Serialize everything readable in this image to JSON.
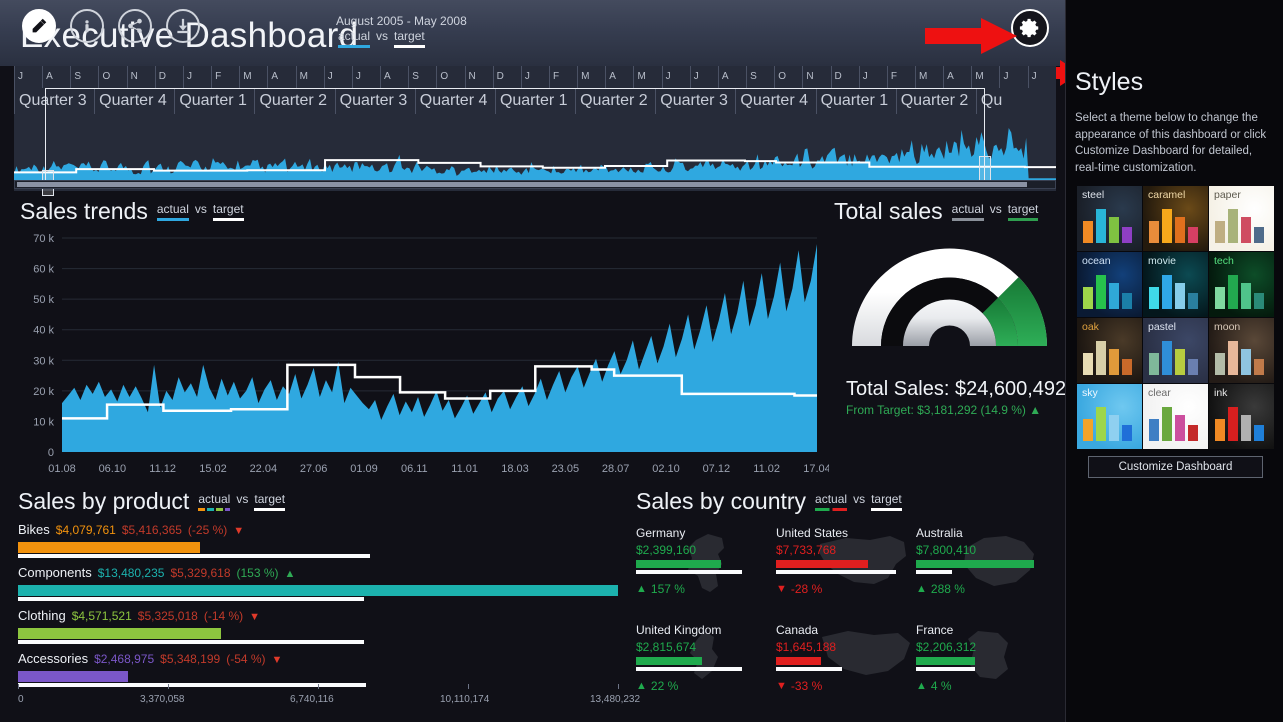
{
  "header": {
    "title": "Executive Dashboard",
    "date_range": "August 2005  -  May 2008",
    "legend": {
      "actual": "actual",
      "vs": "vs",
      "target": "target"
    },
    "gear_icon": "gear-icon",
    "arrow_icon": "red-arrow-icon",
    "colors": {
      "actual": "#2fa8e0",
      "target": "#ffffff"
    }
  },
  "timeline": {
    "months": [
      "J",
      "A",
      "S",
      "O",
      "N",
      "D",
      "J",
      "F",
      "M",
      "A",
      "M",
      "J",
      "J",
      "A",
      "S",
      "O",
      "N",
      "D",
      "J",
      "F",
      "M",
      "A",
      "M",
      "J",
      "J",
      "A",
      "S",
      "O",
      "N",
      "D",
      "J",
      "F",
      "M",
      "A",
      "M",
      "J",
      "J"
    ],
    "quarters": [
      "Quarter 3",
      "Quarter 4",
      "Quarter 1",
      "Quarter 2",
      "Quarter 3",
      "Quarter 4",
      "Quarter 1",
      "Quarter 2",
      "Quarter 3",
      "Quarter 4",
      "Quarter 1",
      "Quarter 2",
      "Qu"
    ]
  },
  "sales_trends": {
    "title": "Sales trends",
    "legend": {
      "actual": "actual",
      "vs": "vs",
      "target": "target"
    }
  },
  "total_sales": {
    "title": "Total sales",
    "legend": {
      "actual": "actual",
      "vs": "vs",
      "target": "target"
    },
    "value_label": "Total Sales: $24,600,492",
    "from_target_label": "From Target: $3,181,292 (14.9 %) ▲",
    "gauge_fill_color": "#2f9e4f",
    "positive_color": "#2faa55"
  },
  "sales_by_product": {
    "title": "Sales by product",
    "legend": {
      "actual": "actual",
      "vs": "vs",
      "target": "target"
    },
    "axis_ticks": [
      "0",
      "3,370,058",
      "6,740,116",
      "10,110,174",
      "13,480,232"
    ],
    "axis_max": 13480232,
    "rows": [
      {
        "name": "Bikes",
        "actual": "$4,079,761",
        "target": "$5,416,365",
        "pct": "(-25 %)",
        "dir": "down",
        "actual_value": 4079761,
        "target_value": 5416365,
        "color": "#f2920d"
      },
      {
        "name": "Components",
        "actual": "$13,480,235",
        "target": "$5,329,618",
        "pct": "(153 %)",
        "dir": "up",
        "actual_value": 13480235,
        "target_value": 5329618,
        "color": "#1cb2ae"
      },
      {
        "name": "Clothing",
        "actual": "$4,571,521",
        "target": "$5,325,018",
        "pct": "(-14 %)",
        "dir": "down",
        "actual_value": 4571521,
        "target_value": 5325018,
        "color": "#8dc63f"
      },
      {
        "name": "Accessories",
        "actual": "$2,468,975",
        "target": "$5,348,199",
        "pct": "(-54 %)",
        "dir": "down",
        "actual_value": 2468975,
        "target_value": 5348199,
        "color": "#7b57c8"
      }
    ]
  },
  "sales_by_country": {
    "title": "Sales by country",
    "legend": {
      "actual": "actual",
      "vs": "vs",
      "target": "target"
    },
    "countries": [
      {
        "name": "Germany",
        "value": "$2,399,160",
        "pct": "157 %",
        "dir": "up",
        "bar_ratio": 0.8,
        "target_ratio": 1.0,
        "map": "germany"
      },
      {
        "name": "United States",
        "value": "$7,733,768",
        "pct": "-28 %",
        "dir": "down",
        "bar_ratio": 0.72,
        "target_ratio": 1.0,
        "map": "usa"
      },
      {
        "name": "Australia",
        "value": "$7,800,410",
        "pct": "288 %",
        "dir": "up",
        "bar_ratio": 0.96,
        "target_ratio": 0.3,
        "map": "australia"
      },
      {
        "name": "United Kingdom",
        "value": "$2,815,674",
        "pct": "22 %",
        "dir": "up",
        "bar_ratio": 0.62,
        "target_ratio": 1.0,
        "map": "uk"
      },
      {
        "name": "Canada",
        "value": "$1,645,188",
        "pct": "-33 %",
        "dir": "down",
        "bar_ratio": 0.42,
        "target_ratio": 0.62,
        "map": "canada"
      },
      {
        "name": "France",
        "value": "$2,206,312",
        "pct": "4 %",
        "dir": "up",
        "bar_ratio": 0.56,
        "target_ratio": 0.56,
        "map": "france"
      }
    ],
    "colors": {
      "up": "#1faa4d",
      "down": "#e01f1f"
    }
  },
  "sidebar": {
    "icons": [
      {
        "name": "edit-pencil-icon",
        "active": true
      },
      {
        "name": "info-icon",
        "active": false
      },
      {
        "name": "share-icon",
        "active": false
      },
      {
        "name": "download-icon",
        "active": false
      }
    ],
    "title": "Styles",
    "description": "Select a theme below to change the appearance of this dashboard or click Customize Dashboard for detailed, real-time customization.",
    "customize_button": "Customize Dashboard",
    "themes": [
      {
        "name": "steel",
        "bg": "#1a1f28",
        "glow": "#2a3a4d",
        "text": "#dfe4ec",
        "bars": [
          "#f08a24",
          "#29b6d8",
          "#7fc241",
          "#8e3fc4"
        ]
      },
      {
        "name": "caramel",
        "bg": "#241a0d",
        "glow": "#6b4a18",
        "text": "#f0d9a8",
        "bars": [
          "#e98c3a",
          "#f7a81b",
          "#e0701d",
          "#d63f63"
        ]
      },
      {
        "name": "paper",
        "bg": "#f5f1e6",
        "glow": "#ffffff",
        "text": "#5d5a4e",
        "bars": [
          "#bfae82",
          "#a8b37a",
          "#cf4d61",
          "#4f6b8a"
        ]
      },
      {
        "name": "ocean",
        "bg": "#0a1a33",
        "glow": "#12407a",
        "text": "#cfe2f7",
        "bars": [
          "#9ed64a",
          "#27c24c",
          "#2fa8d8",
          "#1b7fa8"
        ]
      },
      {
        "name": "movie",
        "bg": "#04171c",
        "glow": "#0c4a52",
        "text": "#cfe9ee",
        "bars": [
          "#3fd9e8",
          "#2fa8e8",
          "#86cdea",
          "#2a7f9e"
        ]
      },
      {
        "name": "tech",
        "bg": "#041a0d",
        "glow": "#0d4d28",
        "text": "#56e07f",
        "bars": [
          "#7fd9a0",
          "#22a84f",
          "#4fc48a",
          "#2a8a78"
        ]
      },
      {
        "name": "oak",
        "bg": "#1c1611",
        "glow": "#4a3a28",
        "text": "#e0a23f",
        "bars": [
          "#e8dcb4",
          "#d8cfa8",
          "#e09a3a",
          "#c96a2a"
        ]
      },
      {
        "name": "pastel",
        "bg": "#2a3045",
        "glow": "#3c4766",
        "text": "#dde3f0",
        "bars": [
          "#7fb89a",
          "#2f8ed8",
          "#b8cc3f",
          "#6a7fb0"
        ]
      },
      {
        "name": "moon",
        "bg": "#241c17",
        "glow": "#5a4838",
        "text": "#d8c8b8",
        "bars": [
          "#b3bca8",
          "#e8b89a",
          "#8fc4e0",
          "#c07a4a"
        ]
      },
      {
        "name": "sky",
        "bg": "#3aa8e0",
        "glow": "#6fc8f0",
        "text": "#f0f8ff",
        "bars": [
          "#f2a32a",
          "#9ed64a",
          "#8fd0f0",
          "#1f6fd8"
        ]
      },
      {
        "name": "clear",
        "bg": "#f2f2f2",
        "glow": "#ffffff",
        "text": "#6a6a6a",
        "bars": [
          "#3f7fc4",
          "#6aa83f",
          "#cc4f9e",
          "#c42a2a"
        ]
      },
      {
        "name": "ink",
        "bg": "#121212",
        "glow": "#3a3a3a",
        "text": "#e8e8e8",
        "bars": [
          "#f08a24",
          "#d81f1f",
          "#b0b0b0",
          "#1f7fd8"
        ]
      }
    ]
  },
  "chart_data": [
    {
      "type": "area",
      "title": "Sales trends",
      "xlabel": "",
      "ylabel": "",
      "ylim": [
        0,
        70000
      ],
      "ytick_labels": [
        "0",
        "10 k",
        "20 k",
        "30 k",
        "40 k",
        "50 k",
        "60 k",
        "70 k"
      ],
      "xtick_labels": [
        "01.08",
        "06.10",
        "11.12",
        "15.02",
        "22.04",
        "27.06",
        "01.09",
        "06.11",
        "11.01",
        "18.03",
        "23.05",
        "28.07",
        "02.10",
        "07.12",
        "11.02",
        "17.04"
      ],
      "grid": true,
      "legend": [
        "actual",
        "target"
      ],
      "series": [
        {
          "name": "actual",
          "color": "#2fa8e0",
          "values": [
            16000,
            18500,
            21000,
            17000,
            22000,
            19000,
            23000,
            18000,
            20500,
            16500,
            22000,
            18000,
            21500,
            17500,
            13000,
            28500,
            14500,
            20000,
            17000,
            24500,
            19500,
            22500,
            18000,
            28500,
            21000,
            17000,
            24000,
            18500,
            23000,
            17500,
            20000,
            24500,
            16000,
            20500,
            23500,
            17000,
            21500,
            19000,
            25500,
            17500,
            22000,
            27500,
            18000,
            23500,
            19500,
            29500,
            16000,
            21000,
            18500,
            16000,
            14000,
            17000,
            10500,
            15000,
            19000,
            12000,
            16500,
            13000,
            18000,
            11500,
            15500,
            20000,
            13500,
            17000,
            11000,
            14500,
            18500,
            12500,
            16000,
            19500,
            13000,
            17500,
            20000,
            14000,
            18000,
            21500,
            15000,
            19000,
            24000,
            17000,
            22000,
            26500,
            19500,
            24500,
            28000,
            21000,
            26000,
            30500,
            23000,
            28500,
            33000,
            25500,
            30000,
            36500,
            27000,
            32500,
            38000,
            29000,
            34500,
            42000,
            31000,
            37000,
            45000,
            33500,
            40000,
            48000,
            36000,
            43000,
            52000,
            38500,
            45500,
            56000,
            41000,
            48000,
            58500,
            43500,
            51000,
            62000,
            46000,
            53500,
            66000,
            49000,
            56000,
            68000
          ]
        }
      ],
      "target_step_line": {
        "name": "target",
        "color": "#ffffff",
        "steps": [
          11000,
          11000,
          11000,
          11000,
          15500,
          15500,
          15500,
          15500,
          15500,
          13500,
          13500,
          13500,
          13500,
          13500,
          13500,
          14000,
          14000,
          14000,
          14000,
          14000,
          28500,
          28500,
          28500,
          28500,
          28500,
          28500,
          24500,
          24500,
          24500,
          24500,
          19500,
          19500,
          19500,
          19500,
          17500,
          17500,
          17500,
          17500,
          20000,
          20000,
          20000,
          20000,
          28000,
          28000,
          28000,
          28000,
          28000,
          27000,
          27000,
          25000,
          25000,
          25000,
          25000,
          25000,
          25000,
          19000,
          19000,
          19000,
          19000,
          19000,
          19000,
          19000,
          19000,
          19000,
          19000,
          18500,
          18500
        ]
      }
    },
    {
      "type": "gauge",
      "title": "Total sales",
      "value": 24600492,
      "value_label": "$24,600,492",
      "from_target": 3181292,
      "from_target_pct": 14.9,
      "fill_fraction": 0.3,
      "fill_color": "#2f9e4f"
    },
    {
      "type": "bar",
      "title": "Sales by product",
      "orientation": "horizontal",
      "categories": [
        "Bikes",
        "Components",
        "Clothing",
        "Accessories"
      ],
      "series": [
        {
          "name": "actual",
          "values": [
            4079761,
            13480235,
            4571521,
            2468975
          ]
        },
        {
          "name": "target",
          "values": [
            5416365,
            5329618,
            5325018,
            5348199
          ]
        }
      ],
      "xlim": [
        0,
        13480232
      ],
      "xtick_labels": [
        "0",
        "3,370,058",
        "6,740,116",
        "10,110,174",
        "13,480,232"
      ],
      "pct_labels": [
        "-25 %",
        "153 %",
        "-14 %",
        "-54 %"
      ]
    },
    {
      "type": "bar",
      "title": "Sales by country",
      "categories": [
        "Germany",
        "United States",
        "Australia",
        "United Kingdom",
        "Canada",
        "France"
      ],
      "series": [
        {
          "name": "actual",
          "values": [
            2399160,
            7733768,
            7800410,
            2815674,
            1645188,
            2206312
          ]
        }
      ],
      "pct_labels": [
        "157 %",
        "-28 %",
        "288 %",
        "22 %",
        "-33 %",
        "4 %"
      ]
    }
  ]
}
